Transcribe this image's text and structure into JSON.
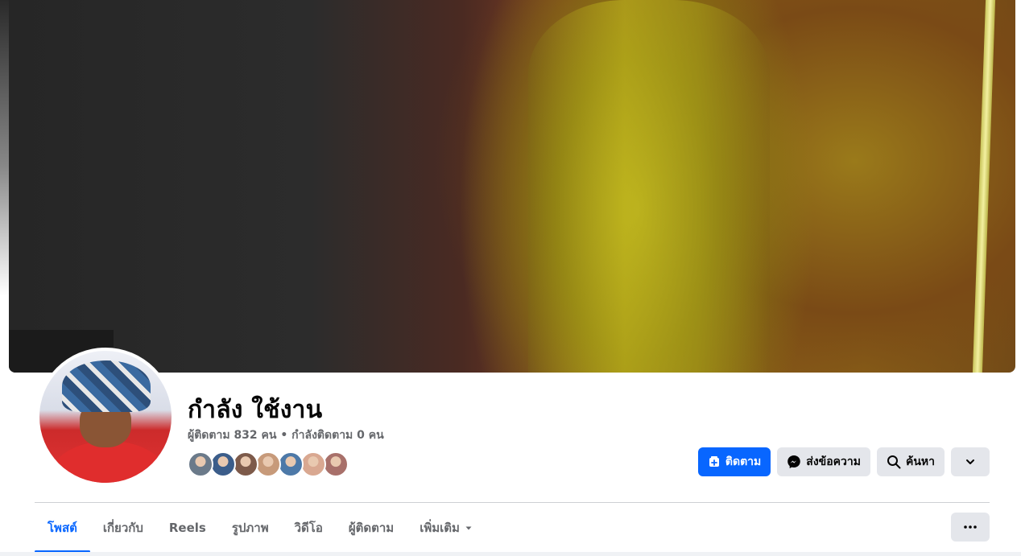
{
  "profile": {
    "name": "กำลัง ใช้งาน",
    "follow_stats": "ผู้ติดตาม 832 คน • กำลังติดตาม 0 คน"
  },
  "friend_avatar_colors": [
    "#6b7a8a",
    "#3b5d8a",
    "#7d5a4a",
    "#c79a7a",
    "#4d79a8",
    "#d9a891",
    "#a8706a"
  ],
  "actions": {
    "follow_label": "ติดตาม",
    "message_label": "ส่งข้อความ",
    "search_label": "ค้นหา"
  },
  "tabs": [
    {
      "label": "โพสต์",
      "active": true
    },
    {
      "label": "เกี่ยวกับ",
      "active": false
    },
    {
      "label": "Reels",
      "active": false
    },
    {
      "label": "รูปภาพ",
      "active": false
    },
    {
      "label": "วิดีโอ",
      "active": false
    },
    {
      "label": "ผู้ติดตาม",
      "active": false
    },
    {
      "label": "เพิ่มเติม",
      "active": false,
      "has_dropdown": true
    }
  ],
  "colors": {
    "accent": "#0866ff",
    "secondary_button": "#e4e6eb",
    "muted_text": "#65676b"
  },
  "icons": {
    "follow": "user-plus-icon",
    "message": "messenger-icon",
    "search": "search-icon",
    "expand": "chevron-down-icon",
    "more": "more-dots-icon",
    "tab_dropdown": "caret-down-icon"
  }
}
